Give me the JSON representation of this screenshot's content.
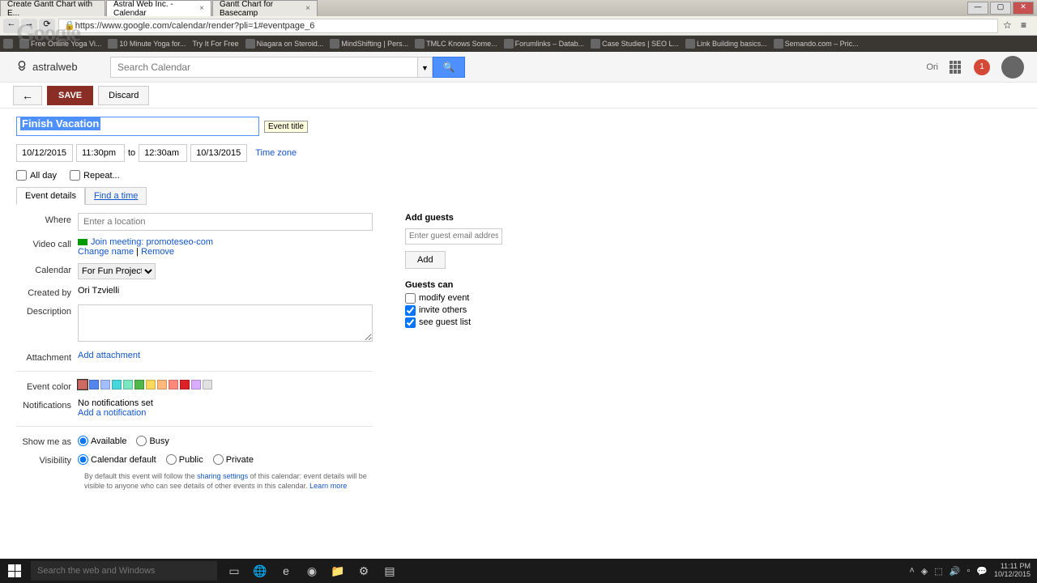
{
  "browser": {
    "tabs": [
      {
        "title": "Create Gantt Chart with E..."
      },
      {
        "title": "Astral Web Inc. - Calendar"
      },
      {
        "title": "Gantt Chart for Basecamp"
      }
    ],
    "url": "https://www.google.com/calendar/render?pli=1#eventpage_6",
    "bookmarks": [
      "Free Online Yoga Vi...",
      "10 Minute Yoga for...",
      "Try It For Free",
      "Niagara on Steroid...",
      "MindShifting | Pers...",
      "TMLC Knows Some...",
      "Forumlinks – Datab...",
      "Case Studies | SEO L...",
      "Link Building basics...",
      "Semando.com – Pric..."
    ]
  },
  "overlay": "Google",
  "header": {
    "logo_text": "astralweb",
    "search_placeholder": "Search Calendar",
    "ori_label": "Ori",
    "notif_count": "1"
  },
  "actions": {
    "save": "SAVE",
    "discard": "Discard"
  },
  "event": {
    "title": "Finish Vacation",
    "tooltip": "Event title",
    "start_date": "10/12/2015",
    "start_time": "11:30pm",
    "to": "to",
    "end_time": "12:30am",
    "end_date": "10/13/2015",
    "timezone": "Time zone",
    "allday": "All day",
    "repeat": "Repeat...",
    "tabs": {
      "details": "Event details",
      "findtime": "Find a time"
    }
  },
  "details": {
    "where_label": "Where",
    "where_placeholder": "Enter a location",
    "video_label": "Video call",
    "video_join": "Join meeting: promoteseo-com",
    "video_change": "Change name",
    "video_remove": "Remove",
    "calendar_label": "Calendar",
    "calendar_value": "For Fun Project",
    "createdby_label": "Created by",
    "createdby_value": "Ori Tzvielli",
    "description_label": "Description",
    "attachment_label": "Attachment",
    "attachment_link": "Add attachment",
    "color_label": "Event color",
    "notif_label": "Notifications",
    "notif_none": "No notifications set",
    "notif_add": "Add a notification",
    "showme_label": "Show me as",
    "available": "Available",
    "busy": "Busy",
    "visibility_label": "Visibility",
    "vis_default": "Calendar default",
    "vis_public": "Public",
    "vis_private": "Private",
    "vis_note_1": "By default this event will follow the ",
    "vis_note_link1": "sharing settings",
    "vis_note_2": " of this calendar: event details will be visible to anyone who can see details of other events in this calendar. ",
    "vis_note_link2": "Learn more"
  },
  "colors": [
    "#d06b64",
    "#5484ed",
    "#a4bdfc",
    "#46d6db",
    "#7ae7bf",
    "#51b749",
    "#fbd75b",
    "#ffb878",
    "#ff887c",
    "#dc2127",
    "#dbadff",
    "#e1e1e1"
  ],
  "guests": {
    "header": "Add guests",
    "placeholder": "Enter guest email addresses",
    "add": "Add",
    "can_header": "Guests can",
    "modify": "modify event",
    "invite": "invite others",
    "seelist": "see guest list"
  },
  "taskbar": {
    "search": "Search the web and Windows",
    "time": "11:11 PM",
    "date": "10/12/2015"
  }
}
